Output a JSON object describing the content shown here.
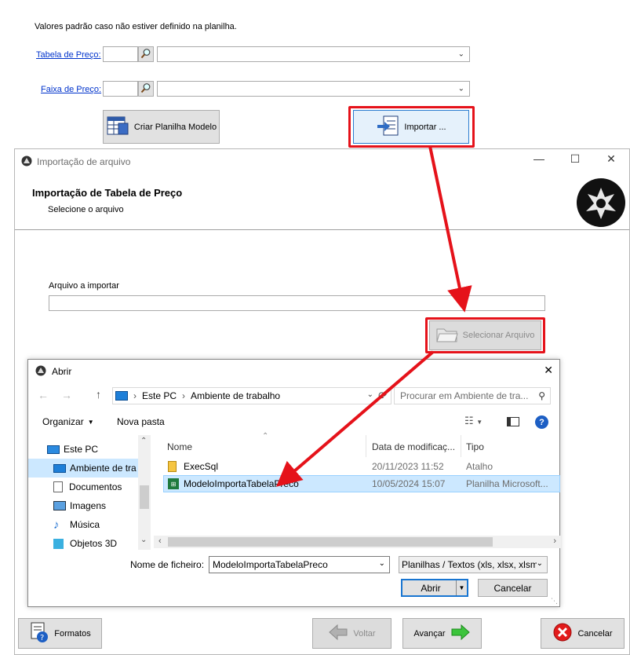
{
  "top_form": {
    "defaults_caption": "Valores padrão caso não estiver definido na planilha.",
    "tabela_label": "Tabela de Preço:",
    "faixa_label": "Faixa de Preço:",
    "criar_button": "Criar Planilha Modelo",
    "importar_button": "Importar ..."
  },
  "import_window": {
    "title": "Importação de arquivo",
    "heading": "Importação de Tabela de Preço",
    "subheading": "Selecione o arquivo",
    "file_label": "Arquivo a importar",
    "file_value": "",
    "select_button": "Selecionar Arquivo"
  },
  "open_dialog": {
    "title": "Abrir",
    "breadcrumb": [
      "Este PC",
      "Ambiente de trabalho"
    ],
    "search_placeholder": "Procurar em Ambiente de tra...",
    "organize": "Organizar",
    "new_folder": "Nova pasta",
    "sidebar": [
      {
        "label": "Este PC",
        "icon": "pc-icon"
      },
      {
        "label": "Ambiente de tra",
        "icon": "desktop-icon",
        "selected": true
      },
      {
        "label": "Documentos",
        "icon": "documents-icon"
      },
      {
        "label": "Imagens",
        "icon": "images-icon"
      },
      {
        "label": "Música",
        "icon": "music-icon"
      },
      {
        "label": "Objetos 3D",
        "icon": "objects3d-icon"
      }
    ],
    "columns": [
      "Nome",
      "Data de modificaç...",
      "Tipo"
    ],
    "files": [
      {
        "name": "ExecSql",
        "date": "20/11/2023 11:52",
        "type": "Atalho",
        "selected": false
      },
      {
        "name": "ModeloImportaTabelaPreco",
        "date": "10/05/2024 15:07",
        "type": "Planilha Microsoft...",
        "selected": true
      }
    ],
    "filename_label": "Nome de ficheiro:",
    "filename_value": "ModeloImportaTabelaPreco",
    "filter_value": "Planilhas / Textos (xls, xlsx, xlsm",
    "open_button": "Abrir",
    "cancel_button": "Cancelar"
  },
  "footer": {
    "formatos": "Formatos",
    "voltar": "Voltar",
    "avancar": "Avançar",
    "cancelar": "Cancelar"
  },
  "colors": {
    "accent_red": "#e5121a",
    "selection_blue": "#cce8ff",
    "link_blue": "#0033cc"
  }
}
